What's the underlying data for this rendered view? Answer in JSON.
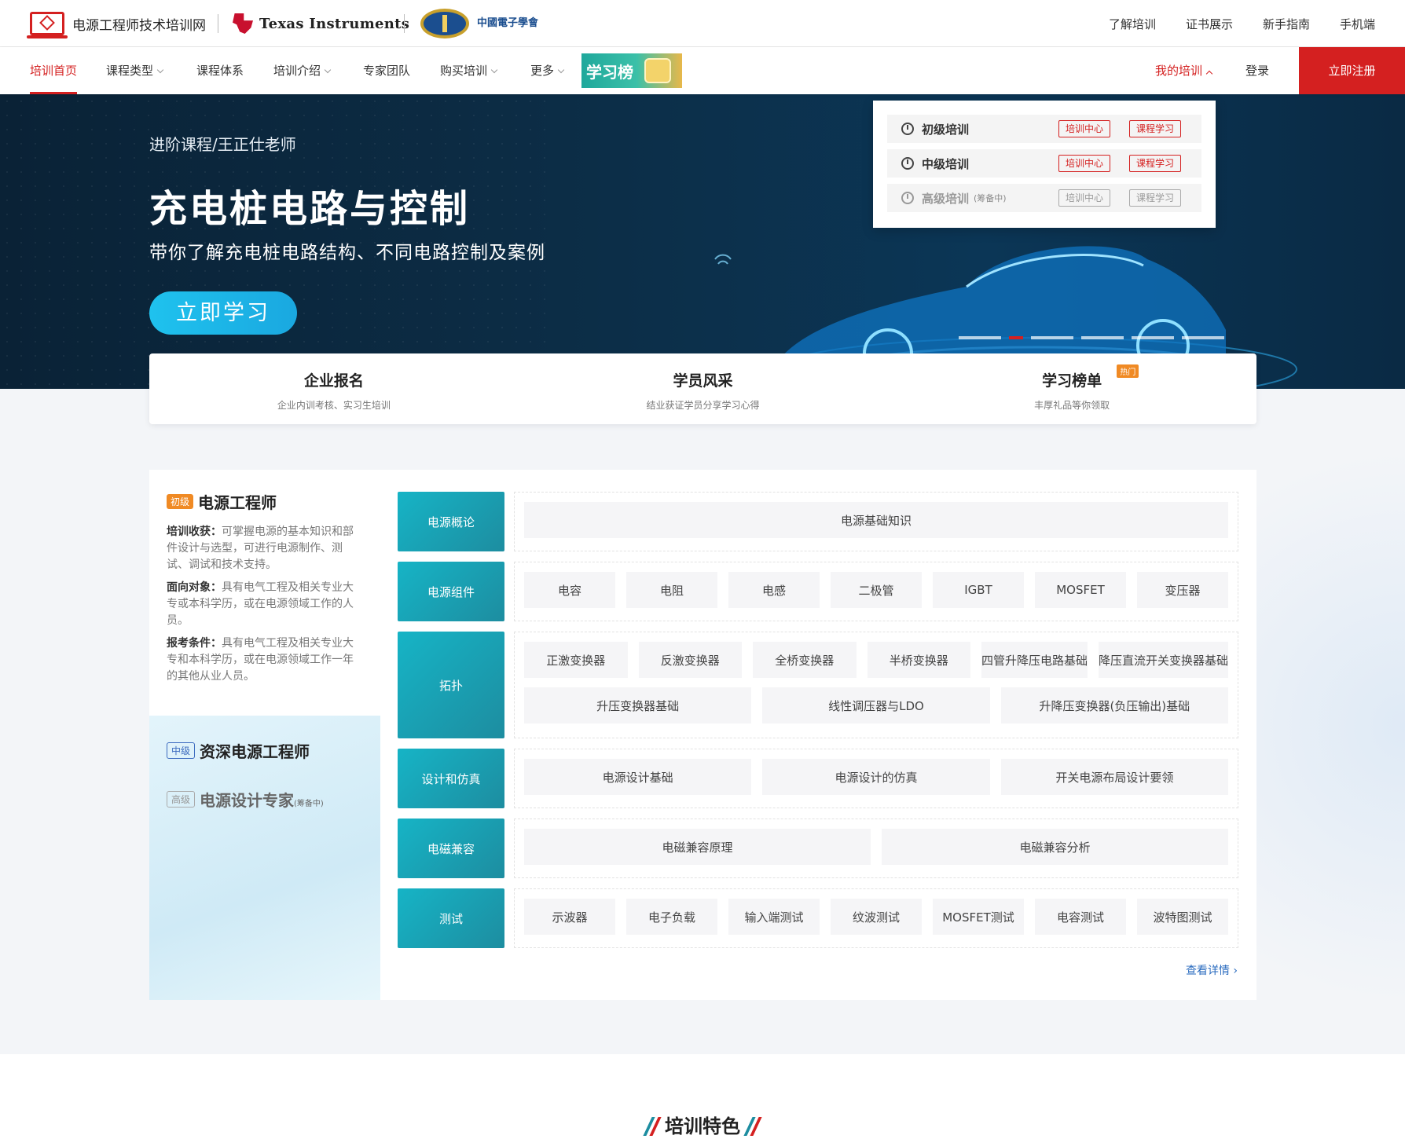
{
  "header": {
    "site_name": "电源工程师技术培训网",
    "ti_name": "Texas Instruments",
    "cie_name": "中國電子學會",
    "top_links": [
      "了解培训",
      "证书展示",
      "新手指南",
      "手机端"
    ]
  },
  "nav": {
    "items": [
      "培训首页",
      "课程类型",
      "课程体系",
      "培训介绍",
      "专家团队",
      "购买培训",
      "更多"
    ],
    "leaderboard": "学习榜",
    "my_training": "我的培训",
    "login": "登录",
    "register": "立即注册"
  },
  "dropdown": {
    "rows": [
      {
        "label": "初级培训",
        "note": "",
        "tag1": "培训中心",
        "tag2": "课程学习"
      },
      {
        "label": "中级培训",
        "note": "",
        "tag1": "培训中心",
        "tag2": "课程学习"
      },
      {
        "label": "高级培训",
        "note": "(筹备中)",
        "tag1": "培训中心",
        "tag2": "课程学习"
      }
    ]
  },
  "hero": {
    "subtitle": "进阶课程/王正仕老师",
    "title": "充电桩电路与控制",
    "desc": "带你了解充电桩电路结构、不同电路控制及案例",
    "button": "立即学习",
    "carousel_count": 6,
    "active_index": 1
  },
  "quick_links": [
    {
      "title": "企业报名",
      "desc": "企业内训考核、实习生培训",
      "hot": ""
    },
    {
      "title": "学员风采",
      "desc": "结业获证学员分享学习心得",
      "hot": ""
    },
    {
      "title": "学习榜单",
      "desc": "丰厚礼品等你领取",
      "hot": "热门"
    }
  ],
  "course": {
    "primary": {
      "badge": "初级",
      "title": "电源工程师",
      "gain_label": "培训收获：",
      "gain": "可掌握电源的基本知识和部件设计与选型，可进行电源制作、测试、调试和技术支持。",
      "target_label": "面向对象：",
      "target": "具有电气工程及相关专业大专或本科学历，或在电源领域工作的人员。",
      "cond_label": "报考条件：",
      "cond": "具有电气工程及相关专业大专和本科学历，或在电源领域工作一年的其他从业人员。"
    },
    "mid": {
      "badge": "中级",
      "title": "资深电源工程师"
    },
    "senior": {
      "badge": "高级",
      "title": "电源设计专家",
      "note": "(筹备中)"
    },
    "categories": [
      {
        "name": "电源概论",
        "rows": [
          [
            "电源基础知识"
          ]
        ]
      },
      {
        "name": "电源组件",
        "rows": [
          [
            "电容",
            "电阻",
            "电感",
            "二极管",
            "IGBT",
            "MOSFET",
            "变压器"
          ]
        ]
      },
      {
        "name": "拓扑",
        "rows": [
          [
            "正激变换器",
            "反激变换器",
            "全桥变换器",
            "半桥变换器",
            "四管升降压电路基础",
            "降压直流开关变换器基础"
          ],
          [
            "升压变换器基础",
            "线性调压器与LDO",
            "升降压变换器(负压输出)基础"
          ]
        ]
      },
      {
        "name": "设计和仿真",
        "rows": [
          [
            "电源设计基础",
            "电源设计的仿真",
            "开关电源布局设计要领"
          ]
        ]
      },
      {
        "name": "电磁兼容",
        "rows": [
          [
            "电磁兼容原理",
            "电磁兼容分析"
          ]
        ]
      },
      {
        "name": "测试",
        "rows": [
          [
            "示波器",
            "电子负载",
            "输入端测试",
            "纹波测试",
            "MOSFET测试",
            "电容测试",
            "波特图测试"
          ]
        ]
      }
    ],
    "more": "查看详情 ›"
  },
  "feature": {
    "title": "培训特色"
  },
  "colors": {
    "accent": "#d42020",
    "teal": "#1d8da0",
    "hero_bg": "#0c2d46"
  }
}
